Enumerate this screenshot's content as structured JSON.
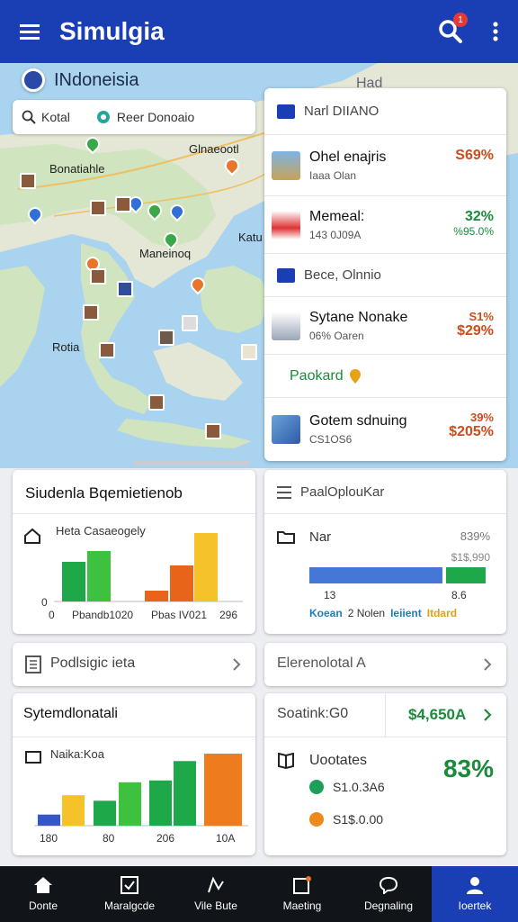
{
  "app": {
    "title": "Simulgia",
    "notification_count": "1"
  },
  "map": {
    "country_label": "INdoneisia",
    "corner_label": "Had",
    "search": {
      "label1": "Kotal",
      "label2": "Reer Donoaio"
    },
    "place_labels": [
      "Glnaeootl",
      "Bonatiahle",
      "Katu",
      "Maneinoq",
      "Rotia"
    ]
  },
  "side_list": {
    "sections": [
      {
        "type": "header",
        "label": "Narl DIIANO"
      },
      {
        "type": "item",
        "name": "Ohel enajris",
        "sub": "Iaaa Olan",
        "value": "S69%",
        "value2": "",
        "value_color": "#d04a1a"
      },
      {
        "type": "item",
        "name": "Memeal:",
        "sub": "143 0J09A",
        "value": "32%",
        "value2": "%95.0%",
        "value_color": "#1b8a3a"
      },
      {
        "type": "header",
        "label": "Bece, Olnnio"
      },
      {
        "type": "item",
        "name": "Sytane Nonake",
        "sub": "06% Oaren",
        "value": "S1%",
        "value2": "$29%",
        "value_color": "#d04a1a"
      },
      {
        "type": "item",
        "name": "Paokard",
        "sub": "",
        "value": "",
        "value2": "",
        "value_color": "#1b8a3a"
      },
      {
        "type": "item",
        "name": "Gotem sdnuing",
        "sub": "CS1OS6",
        "value": "39%",
        "value2": "$205%",
        "value_color": "#d04a1a"
      }
    ]
  },
  "card_left1": {
    "title": "Siudenla Bqemietienob",
    "chart_label": "Heta Casaeogely",
    "axis": [
      "0",
      "0",
      "Pbandb1020",
      "Pbas IV021",
      "296"
    ]
  },
  "card_right1": {
    "title": "PaalOplouKar",
    "row_label": "Nar",
    "pct": "839%",
    "amount": "$1$,990",
    "tick1": "13",
    "tick2": "8.6",
    "legend": [
      "Koean",
      "2 Nolen",
      "Ieiient",
      "Itdard"
    ]
  },
  "card_left2": {
    "title": "Podlsigic ieta"
  },
  "card_right2": {
    "title": "Elerenolotal A"
  },
  "card_left3": {
    "title": "Sytemdlonatali",
    "chart_label": "Naika:Koa",
    "axis": [
      "180",
      "80",
      "206",
      "10A"
    ]
  },
  "card_right3": {
    "top_label": "Soatink:G0",
    "top_value": "$4,650A",
    "title": "Uootates",
    "pct": "83%",
    "row1": "S1.0.3A6",
    "row2": "S1$.0.00"
  },
  "nav": [
    {
      "label": "Donte"
    },
    {
      "label": "Maralgcde"
    },
    {
      "label": "Vile Bute"
    },
    {
      "label": "Maeting"
    },
    {
      "label": "Degnaling"
    },
    {
      "label": "Ioertek"
    }
  ],
  "chart_data": [
    {
      "type": "bar",
      "title": "Siudenla Bqemietienob",
      "subtitle": "Heta Casaeogely",
      "categories": [
        "Pbandb1020",
        "Pbas IV021"
      ],
      "series": [
        {
          "color": "#1fa84a",
          "values": [
            44,
            0
          ]
        },
        {
          "color": "#3ec13f",
          "values": [
            56,
            0
          ]
        },
        {
          "color": "#e8641a",
          "values": [
            0,
            12
          ]
        },
        {
          "color": "#e8641a",
          "values": [
            0,
            40
          ]
        },
        {
          "color": "#f5c22a",
          "values": [
            0,
            76
          ]
        }
      ],
      "ylim": [
        0,
        80
      ]
    },
    {
      "type": "bar",
      "title": "PaalOplouKar",
      "categories": [
        "Nar"
      ],
      "series": [
        {
          "color": "#4477d6",
          "values": [
            77
          ]
        },
        {
          "color": "#1fa84a",
          "values": [
            23
          ]
        }
      ]
    },
    {
      "type": "bar",
      "title": "Sytemdlonatali",
      "subtitle": "Naika:Koa",
      "categories": [
        "180",
        "80",
        "206",
        "10A"
      ],
      "values": [
        12,
        33,
        27,
        47,
        49,
        70,
        78
      ],
      "colors": [
        "#3557c8",
        "#f5c22a",
        "#1fa84a",
        "#3ec13f",
        "#1fa84a",
        "#1fa84a",
        "#ee7b1d"
      ],
      "ylim": [
        0,
        80
      ]
    }
  ]
}
